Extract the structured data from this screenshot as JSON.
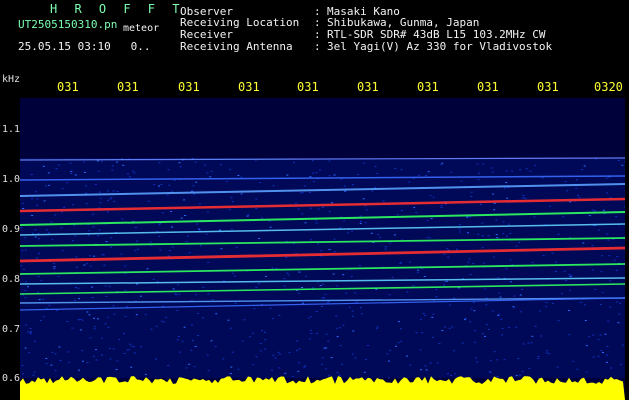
{
  "header": {
    "title": "H R O F F T",
    "filename": "UT2505150310.pn",
    "filename_suffix": "meteor",
    "datetime": "25.05.15 03:10",
    "datetime_extra": "0..",
    "observer_label": "Observer",
    "observer_value": "Masaki Kano",
    "location_label": "Receiving Location",
    "location_value": "Shibukawa, Gunma, Japan",
    "receiver_label": "Receiver",
    "receiver_value": "RTL-SDR SDR# 43dB L15 103.2MHz CW",
    "antenna_label": "Receiving Antenna",
    "antenna_value": "3el Yagi(V) Az 330 for Vladivostok",
    "sep": ":"
  },
  "axes": {
    "y_unit": "kHz",
    "y_ticks": [
      "1.1",
      "1.0",
      "0.9",
      "0.8",
      "0.7",
      "0.6"
    ],
    "x_ticks": [
      "031",
      "031",
      "031",
      "031",
      "031",
      "031",
      "031",
      "031",
      "031",
      "0320"
    ]
  },
  "colors": {
    "background": "#000000",
    "spectrogram_bg": "#00003a",
    "axis_text": "#ffff33",
    "title": "#7cffb0",
    "strong_signal": "#ff3030",
    "mid_signal": "#30ff60",
    "weak_signal": "#3060ff",
    "noise_band": "#ffff00"
  }
}
